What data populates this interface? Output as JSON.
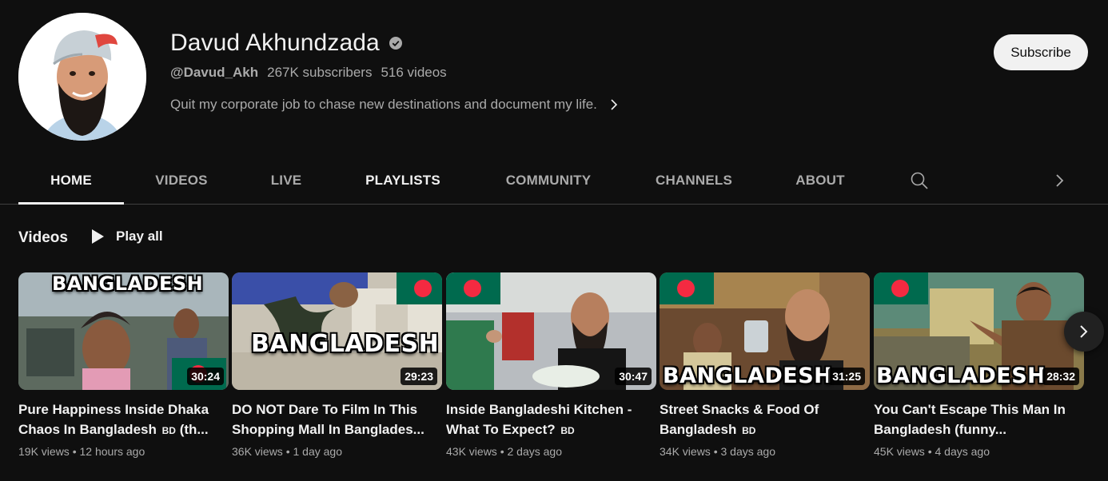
{
  "channel": {
    "name": "Davud Akhundzada",
    "handle": "@Davud_Akh",
    "subscribers": "267K subscribers",
    "videos_count": "516 videos",
    "description": "Quit my corporate job to chase new destinations and document my life.",
    "subscribe_label": "Subscribe"
  },
  "tabs": [
    "HOME",
    "VIDEOS",
    "LIVE",
    "PLAYLISTS",
    "COMMUNITY",
    "CHANNELS",
    "ABOUT"
  ],
  "section": {
    "title": "Videos",
    "play_all": "Play all"
  },
  "videos": [
    {
      "title": "Pure Happiness Inside Dhaka Chaos In Bangladesh",
      "title_tail": "(th...",
      "duration": "30:24",
      "thumb_text": "BANGLADESH",
      "views": "19K views",
      "age": "12 hours ago"
    },
    {
      "title": "DO NOT Dare To Film In This Shopping Mall In Banglades...",
      "title_tail": "",
      "duration": "29:23",
      "thumb_text": "BANGLADESH",
      "views": "36K views",
      "age": "1 day ago"
    },
    {
      "title": "Inside Bangladeshi Kitchen - What To Expect?",
      "title_tail": "",
      "duration": "30:47",
      "thumb_text": "",
      "views": "43K views",
      "age": "2 days ago"
    },
    {
      "title": "Street Snacks & Food Of Bangladesh",
      "title_tail": "",
      "duration": "31:25",
      "thumb_text": "BANGLADESH",
      "views": "34K views",
      "age": "3 days ago"
    },
    {
      "title": "You Can't Escape This Man In Bangladesh (funny...",
      "title_tail": "",
      "duration": "28:32",
      "thumb_text": "BANGLADESH",
      "views": "45K views",
      "age": "4 days ago"
    }
  ],
  "bd_tag": "BD",
  "separator": "•",
  "icons": {
    "verified": "check-circle-icon",
    "description_more": "chevron-right-icon",
    "search": "search-icon",
    "tabs_next": "chevron-right-icon",
    "play_all": "play-icon",
    "carousel_next": "chevron-right-icon"
  },
  "colors": {
    "background": "#0f0f0f",
    "text_primary": "#f1f1f1",
    "text_secondary": "#aaaaaa",
    "subscribe_bg": "#f1f1f1",
    "flag_green": "#006a4e",
    "flag_red": "#f42a41"
  }
}
